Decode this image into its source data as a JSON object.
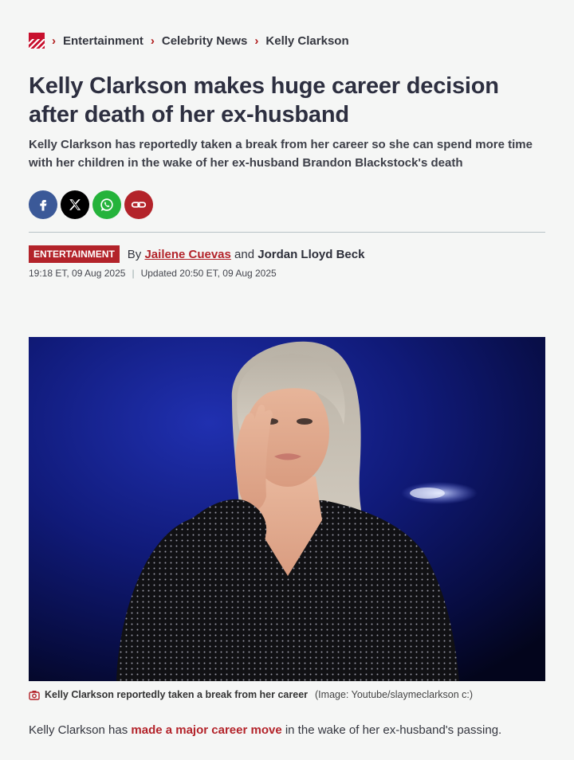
{
  "breadcrumb": {
    "logo_text": "Mirror",
    "items": [
      "Entertainment",
      "Celebrity News",
      "Kelly Clarkson"
    ]
  },
  "article": {
    "headline": "Kelly Clarkson makes huge career decision after death of her ex-husband",
    "standfirst": "Kelly Clarkson has reportedly taken a break from her career so she can spend more time with her children in the wake of her ex-husband Brandon Blackstock's death",
    "category_tag": "ENTERTAINMENT",
    "by_prefix": "By",
    "author_1": "Jailene Cuevas",
    "and_text": "and",
    "author_2": "Jordan Lloyd Beck",
    "published": "19:18 ET, 09 Aug 2025",
    "updated": "Updated 20:50 ET, 09 Aug 2025",
    "image_caption": "Kelly Clarkson reportedly taken a break from her career",
    "image_credit": "(Image: Youtube/slaymeclarkson c:)",
    "body_prefix": "Kelly Clarkson has ",
    "body_link": "made a major career move",
    "body_suffix": " in the wake of her ex-husband's passing."
  },
  "share": {
    "icons": [
      "facebook-icon",
      "x-icon",
      "whatsapp-icon",
      "copy-link-icon"
    ]
  },
  "colors": {
    "accent": "#b3232a",
    "facebook": "#3b5998",
    "x": "#000000",
    "whatsapp": "#25b33b",
    "background": "#f5f6f5"
  }
}
